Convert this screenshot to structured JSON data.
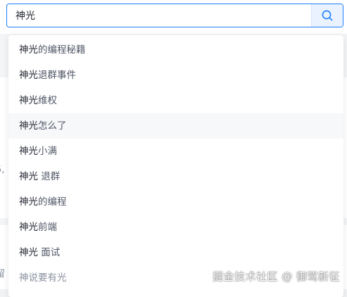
{
  "search": {
    "value": "神光",
    "placeholder": ""
  },
  "suggestions": [
    {
      "keyword": "神光",
      "rest": "的编程秘籍"
    },
    {
      "keyword": "神光",
      "rest": "退群事件"
    },
    {
      "keyword": "神光",
      "rest": "维权"
    },
    {
      "keyword": "神光",
      "rest": "怎么了"
    },
    {
      "keyword": "神光",
      "rest": "小满"
    },
    {
      "keyword": "神光",
      "rest": " 退群"
    },
    {
      "keyword": "神光",
      "rest": "的编程"
    },
    {
      "keyword": "神光",
      "rest": "前端"
    },
    {
      "keyword": "神光",
      "rest": " 面试"
    },
    {
      "keyword": "",
      "rest": "神说要有光"
    }
  ],
  "background": {
    "edge_chars": [
      "5,",
      "留"
    ]
  },
  "watermark": "掘金技术社区 @ 御驾新征",
  "colors": {
    "accent": "#1e80ff",
    "search_button_bg": "#eaf2ff",
    "hover_row": "#f7f8fa"
  }
}
